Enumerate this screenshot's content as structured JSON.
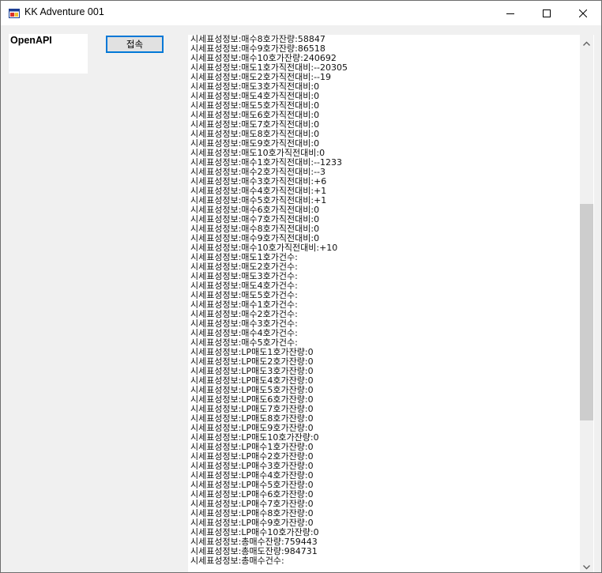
{
  "window": {
    "title": "KK Adventure 001",
    "icon": "app-window-icon"
  },
  "left_panel": {
    "label": "OpenAPI"
  },
  "toolbar": {
    "connect_label": "접속"
  },
  "log": {
    "lines": [
      "시세표성정보:매수8호가잔량:58847",
      "시세표성정보:매수9호가잔량:86518",
      "시세표성정보:매수10호가잔량:240692",
      "시세표성정보:매도1호가직전대비:--20305",
      "시세표성정보:매도2호가직전대비:--19",
      "시세표성정보:매도3호가직전대비:0",
      "시세표성정보:매도4호가직전대비:0",
      "시세표성정보:매도5호가직전대비:0",
      "시세표성정보:매도6호가직전대비:0",
      "시세표성정보:매도7호가직전대비:0",
      "시세표성정보:매도8호가직전대비:0",
      "시세표성정보:매도9호가직전대비:0",
      "시세표성정보:매도10호가직전대비:0",
      "시세표성정보:매수1호가직전대비:--1233",
      "시세표성정보:매수2호가직전대비:--3",
      "시세표성정보:매수3호가직전대비:+6",
      "시세표성정보:매수4호가직전대비:+1",
      "시세표성정보:매수5호가직전대비:+1",
      "시세표성정보:매수6호가직전대비:0",
      "시세표성정보:매수7호가직전대비:0",
      "시세표성정보:매수8호가직전대비:0",
      "시세표성정보:매수9호가직전대비:0",
      "시세표성정보:매수10호가직전대비:+10",
      "시세표성정보:매도1호가건수:",
      "시세표성정보:매도2호가건수:",
      "시세표성정보:매도3호가건수:",
      "시세표성정보:매도4호가건수:",
      "시세표성정보:매도5호가건수:",
      "시세표성정보:매수1호가건수:",
      "시세표성정보:매수2호가건수:",
      "시세표성정보:매수3호가건수:",
      "시세표성정보:매수4호가건수:",
      "시세표성정보:매수5호가건수:",
      "시세표성정보:LP매도1호가잔량:0",
      "시세표성정보:LP매도2호가잔량:0",
      "시세표성정보:LP매도3호가잔량:0",
      "시세표성정보:LP매도4호가잔량:0",
      "시세표성정보:LP매도5호가잔량:0",
      "시세표성정보:LP매도6호가잔량:0",
      "시세표성정보:LP매도7호가잔량:0",
      "시세표성정보:LP매도8호가잔량:0",
      "시세표성정보:LP매도9호가잔량:0",
      "시세표성정보:LP매도10호가잔량:0",
      "시세표성정보:LP매수1호가잔량:0",
      "시세표성정보:LP매수2호가잔량:0",
      "시세표성정보:LP매수3호가잔량:0",
      "시세표성정보:LP매수4호가잔량:0",
      "시세표성정보:LP매수5호가잔량:0",
      "시세표성정보:LP매수6호가잔량:0",
      "시세표성정보:LP매수7호가잔량:0",
      "시세표성정보:LP매수8호가잔량:0",
      "시세표성정보:LP매수9호가잔량:0",
      "시세표성정보:LP매수10호가잔량:0",
      "시세표성정보:총매수잔량:759443",
      "시세표성정보:총매도잔량:984731",
      "시세표성정보:총매수건수:"
    ]
  },
  "scrollbar": {
    "position_fraction": 0.53
  }
}
